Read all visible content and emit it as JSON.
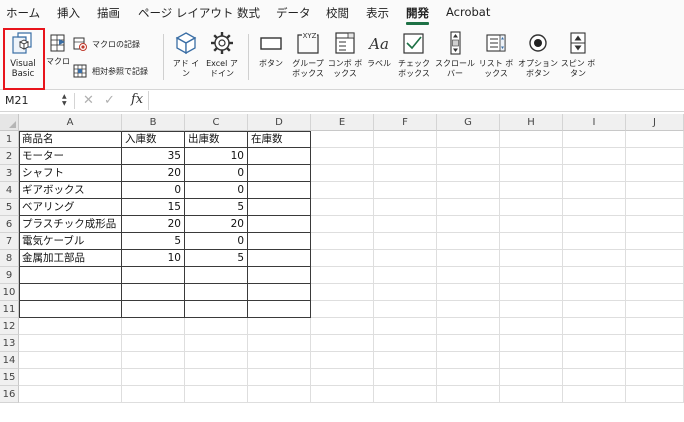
{
  "ribbon_tabs": [
    "ホーム",
    "挿入",
    "描画",
    "ページ レイアウト",
    "数式",
    "データ",
    "校閲",
    "表示",
    "開発",
    "Acrobat"
  ],
  "active_tab": "開発",
  "ribbon": {
    "visual_basic": "Visual Basic",
    "macro": "マクロ",
    "record_macro": "マクロの記録",
    "relative_ref": "相対参照で記録",
    "addins": "アド イン",
    "excel_addins": "Excel アドイン",
    "button": "ボタン",
    "group_box": "グループ ボックス",
    "combo_box": "コンボ ボックス",
    "label": "ラベル",
    "check_box": "チェック ボックス",
    "scroll_bar": "スクロール バー",
    "list_box": "リスト ボックス",
    "option_button": "オプション ボタン",
    "spin_button": "スピン ボタン",
    "group_box_icon_text": "XYZ",
    "label_icon_text": "Aa"
  },
  "formula_bar": {
    "name_box": "M21",
    "fx_label": "fx",
    "cancel": "✕",
    "enter": "✓",
    "formula": ""
  },
  "columns": [
    "A",
    "B",
    "C",
    "D",
    "E",
    "F",
    "G",
    "H",
    "I",
    "J"
  ],
  "rows": [
    "1",
    "2",
    "3",
    "4",
    "5",
    "6",
    "7",
    "8",
    "9",
    "10",
    "11",
    "12",
    "13",
    "14",
    "15",
    "16"
  ],
  "table": {
    "headers": [
      "商品名",
      "入庫数",
      "出庫数",
      "在庫数"
    ],
    "rows": [
      [
        "モーター",
        "35",
        "10",
        ""
      ],
      [
        "シャフト",
        "20",
        "0",
        ""
      ],
      [
        "ギアボックス",
        "0",
        "0",
        ""
      ],
      [
        "ベアリング",
        "15",
        "5",
        ""
      ],
      [
        "プラスチック成形品",
        "20",
        "20",
        ""
      ],
      [
        "電気ケーブル",
        "5",
        "0",
        ""
      ],
      [
        "金属加工部品",
        "10",
        "5",
        ""
      ],
      [
        "",
        "",
        "",
        ""
      ],
      [
        "",
        "",
        "",
        ""
      ],
      [
        "",
        "",
        "",
        ""
      ]
    ]
  },
  "colors": {
    "accent_green": "#1e7145",
    "highlight_red": "#e8141c",
    "icon_blue": "#3a6ea5"
  }
}
